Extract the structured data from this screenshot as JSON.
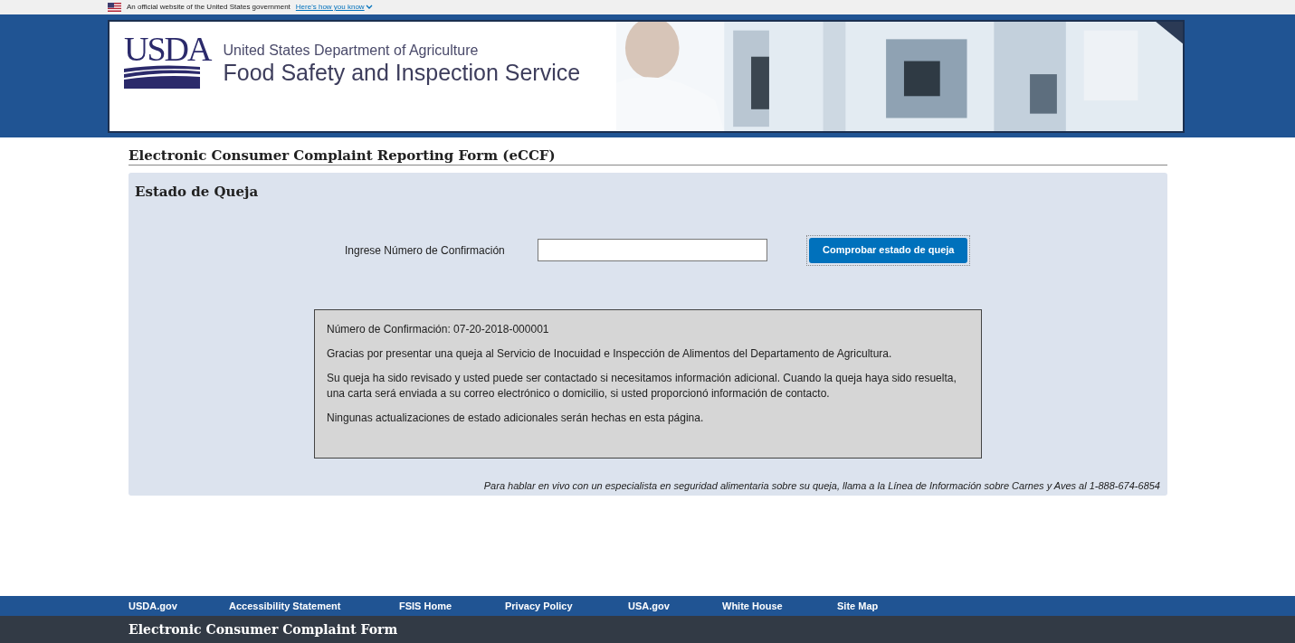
{
  "gov_banner": {
    "text": "An official website of the United States government",
    "link": "Here's how you know"
  },
  "header": {
    "logo": "USDA",
    "agency": "United States Department of Agriculture",
    "service": "Food Safety and Inspection Service"
  },
  "page_title": "Electronic Consumer Complaint Reporting Form (eCCF)",
  "panel": {
    "title": "Estado de Queja",
    "field_label": "Ingrese Número de Confirmación",
    "button": "Comprobar estado de queja",
    "message": [
      "Número de Confirmación: 07-20-2018-000001",
      "Gracias por presentar una queja al Servicio de Inocuidad e Inspección de Alimentos del Departamento de Agricultura.",
      "Su queja ha sido revisado y usted puede ser contactado si necesitamos información adicional. Cuando la queja haya sido resuelta, una carta será enviada a su correo electrónico o domicilio, si usted proporcionó información de contacto.",
      "Ningunas actualizaciones de estado adicionales serán hechas en esta página."
    ],
    "note": "Para hablar en vivo con un especialista en seguridad alimentaria sobre su queja, llama a la Línea de Información sobre Carnes y Aves al 1-888-674-6854"
  },
  "footer_links": [
    "USDA.gov",
    "Accessibility Statement",
    "FSIS Home",
    "Privacy Policy",
    "USA.gov",
    "White House",
    "Site Map"
  ],
  "footer_title": "Electronic Consumer Complaint Form"
}
